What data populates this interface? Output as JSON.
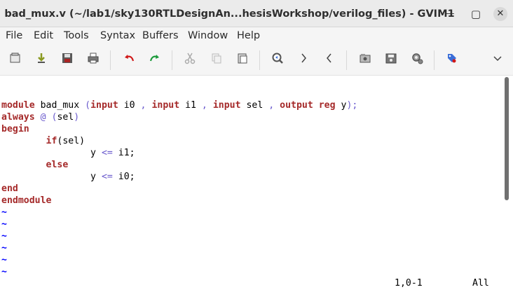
{
  "window": {
    "title": "bad_mux.v (~/lab1/sky130RTLDesignAn...hesisWorkshop/verilog_files) - GVIM1",
    "minimize_glyph": "—",
    "maximize_glyph": "▢",
    "close_glyph": "✕"
  },
  "menu": [
    "File",
    "Edit",
    "Tools",
    "Syntax",
    "Buffers",
    "Window",
    "Help"
  ],
  "toolbar": {
    "icons": [
      "open-icon",
      "save-download-icon",
      "save-icon",
      "print-icon",
      "undo-icon",
      "redo-icon",
      "cut-icon",
      "copy-icon",
      "paste-icon",
      "find-replace-icon",
      "find-next-icon",
      "find-prev-icon",
      "load-session-icon",
      "save-session-icon",
      "run-script-icon",
      "tag-jump-icon",
      "chevron-down-icon"
    ],
    "overflow_glyph": "⌄"
  },
  "code": {
    "line1": {
      "t1": "module",
      "t2": " bad_mux ",
      "t3": "(",
      "t4": "input",
      "t5": " i0 ",
      "t6": ",",
      "t7": " ",
      "t8": "input",
      "t9": " i1 ",
      "t10": ",",
      "t11": " ",
      "t12": "input",
      "t13": " sel ",
      "t14": ",",
      "t15": " ",
      "t16": "output",
      "t17": " ",
      "t18": "reg",
      "t19": " y",
      ")": ")",
      "t20": ");"
    },
    "line2": {
      "t1": "always",
      "t2": " ",
      "t3": "@",
      "t4": " ",
      "t5": "(",
      "t6": "sel",
      "t7": ")"
    },
    "line3": "begin",
    "line4": {
      "indent": "        ",
      "kw": "if",
      "rest": "(sel)"
    },
    "line5": {
      "indent": "                ",
      "a": "y ",
      "op": "<=",
      "b": " i1;"
    },
    "line6": {
      "indent": "        ",
      "kw": "else"
    },
    "line7": {
      "indent": "                ",
      "a": "y ",
      "op": "<=",
      "b": " i0;"
    },
    "line8": "end",
    "line9": "endmodule",
    "tilde": "~"
  },
  "status": {
    "position": "1,0-1",
    "scroll": "All"
  },
  "colors": {
    "keyword": "#a52a2a",
    "operator": "#6a5acd",
    "tilde": "#0000ff"
  }
}
